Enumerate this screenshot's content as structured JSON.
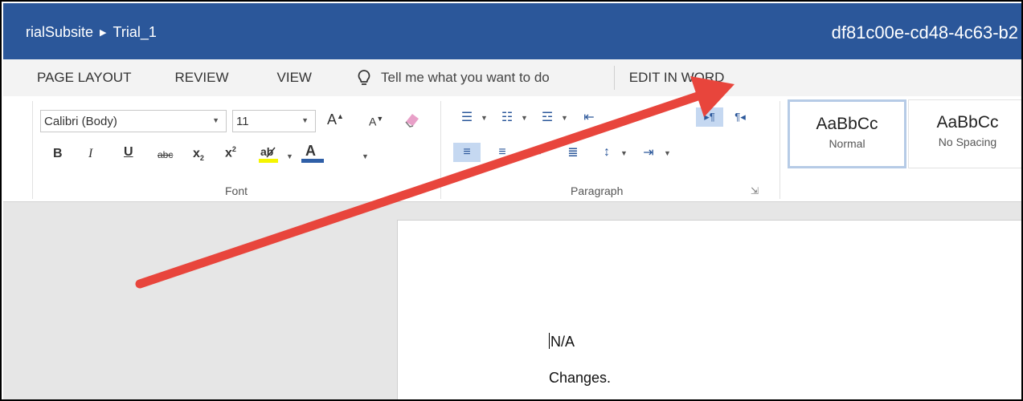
{
  "titlebar": {
    "breadcrumb": [
      "rialSubsite",
      "Trial_1"
    ],
    "doc_id": "df81c00e-cd48-4c63-b2"
  },
  "tabs": {
    "page_layout": "PAGE LAYOUT",
    "review": "REVIEW",
    "view": "VIEW",
    "tell_me": "Tell me what you want to do",
    "edit_in_word": "EDIT IN WORD"
  },
  "ribbon": {
    "font": {
      "label": "Font",
      "font_name": "Calibri (Body)",
      "font_size": "11",
      "strikethrough": "abc"
    },
    "paragraph": {
      "label": "Paragraph"
    },
    "styles": [
      {
        "sample": "AaBbCc",
        "name": "Normal"
      },
      {
        "sample": "AaBbCc",
        "name": "No Spacing"
      }
    ]
  },
  "document": {
    "lines": [
      "N/A",
      "Changes."
    ]
  },
  "colors": {
    "title_bar": "#2b579a",
    "tab_bar": "#f3f3f3",
    "workspace": "#e6e6e6",
    "annotation_arrow": "#e8453c"
  }
}
